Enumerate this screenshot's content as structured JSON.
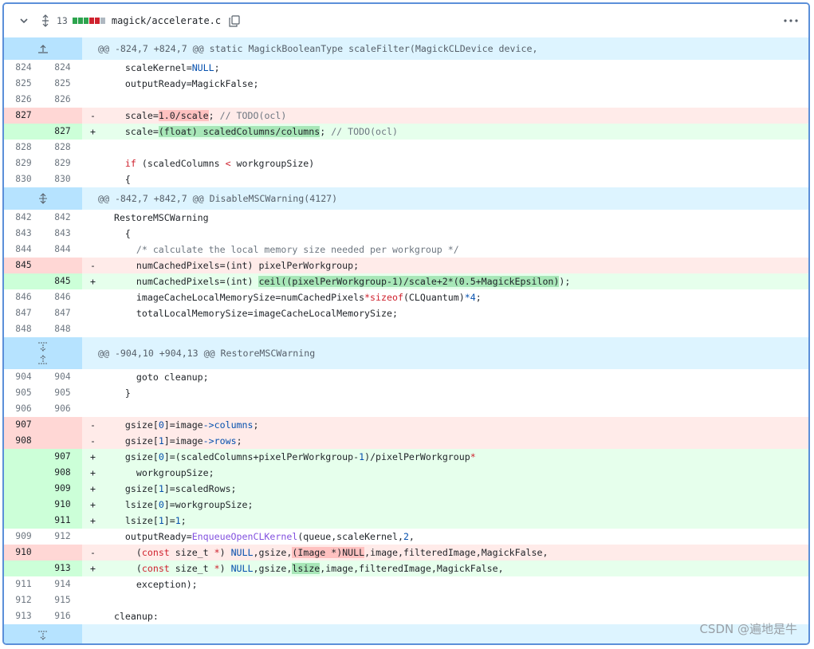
{
  "file": {
    "name": "magick/accelerate.c",
    "changes": "13",
    "diffstat": [
      "#2da44e",
      "#2da44e",
      "#2da44e",
      "#cf222e",
      "#cf222e",
      "#afb8c1"
    ]
  },
  "hunks": {
    "h1": "@@ -824,7 +824,7 @@ static MagickBooleanType scaleFilter(MagickCLDevice device,",
    "h2": "@@ -842,7 +842,7 @@ DisableMSCWarning(4127)",
    "h3": "@@ -904,10 +904,13 @@ RestoreMSCWarning"
  },
  "lines": {
    "l824": {
      "o": "824",
      "n": "824"
    },
    "l825": {
      "o": "825",
      "n": "825"
    },
    "l826": {
      "o": "826",
      "n": "826"
    },
    "l827d": {
      "o": "827",
      "s": "-"
    },
    "l827a": {
      "n": "827",
      "s": "+"
    },
    "l828": {
      "o": "828",
      "n": "828"
    },
    "l829": {
      "o": "829",
      "n": "829"
    },
    "l830": {
      "o": "830",
      "n": "830"
    },
    "l842": {
      "o": "842",
      "n": "842"
    },
    "l843": {
      "o": "843",
      "n": "843"
    },
    "l844": {
      "o": "844",
      "n": "844"
    },
    "l845d": {
      "o": "845",
      "s": "-"
    },
    "l845a": {
      "n": "845",
      "s": "+"
    },
    "l846": {
      "o": "846",
      "n": "846"
    },
    "l847": {
      "o": "847",
      "n": "847"
    },
    "l848": {
      "o": "848",
      "n": "848"
    },
    "l904": {
      "o": "904",
      "n": "904"
    },
    "l905": {
      "o": "905",
      "n": "905"
    },
    "l906": {
      "o": "906",
      "n": "906"
    },
    "l907d": {
      "o": "907",
      "s": "-"
    },
    "l908d": {
      "o": "908",
      "s": "-"
    },
    "a907": {
      "n": "907",
      "s": "+"
    },
    "a908": {
      "n": "908",
      "s": "+"
    },
    "a909": {
      "n": "909",
      "s": "+"
    },
    "a910": {
      "n": "910",
      "s": "+"
    },
    "a911": {
      "n": "911",
      "s": "+"
    },
    "l909": {
      "o": "909",
      "n": "912"
    },
    "l910d": {
      "o": "910",
      "s": "-"
    },
    "a913": {
      "n": "913",
      "s": "+"
    },
    "l911": {
      "o": "911",
      "n": "914"
    },
    "l912": {
      "o": "912",
      "n": "915"
    },
    "l913": {
      "o": "913",
      "n": "916"
    }
  },
  "code": {
    "c824a": "    scaleKernel=",
    "c824b": "NULL",
    "c824c": ";",
    "c825": "    outputReady=MagickFalse;",
    "c827d1": "    scale=",
    "c827d2": "1.0/scale",
    "c827d3": "; ",
    "c827d4": "// TODO(ocl)",
    "c827a1": "    scale=",
    "c827a2": "(float) scaledColumns/columns",
    "c827a3": "; ",
    "c827a4": "// TODO(ocl)",
    "c829a": "    ",
    "c829b": "if",
    "c829c": " (scaledColumns ",
    "c829d": "<",
    "c829e": " workgroupSize)",
    "c830": "    {",
    "c842": "  RestoreMSCWarning",
    "c843": "    {",
    "c844": "      /* calculate the local memory size needed per workgroup */",
    "c845d1": "      numCachedPixels=",
    "c845d2": "(int)",
    "c845d3": " pixelPerWorkgroup;",
    "c845a1": "      numCachedPixels=",
    "c845a2": "(int)",
    "c845a3": " ",
    "c845a4": "ceil((pixelPerWorkgroup",
    "c845a5": "-1)/scale+2*(0.5+MagickEpsilon)",
    "c845a6": ");",
    "c846a": "      imageCacheLocalMemorySize=numCachedPixels",
    "c846b": "*",
    "c846c": "sizeof",
    "c846d": "(CLQuantum)",
    "c846e": "*4",
    "c846f": ";",
    "c847": "      totalLocalMemorySize=imageCacheLocalMemorySize;",
    "c904": "      goto cleanup;",
    "c905": "    }",
    "c907da": "    gsize[",
    "c907db": "0",
    "c907dc": "]=image",
    "c907dd": "->columns",
    "c907de": ";",
    "c908da": "    gsize[",
    "c908db": "1",
    "c908dc": "]=image",
    "c908dd": "->rows",
    "c908de": ";",
    "a907a": "    gsize[",
    "a907b": "0",
    "a907c": "]=(scaledColumns+pixelPerWorkgroup-",
    "a907d": "1",
    "a907e": ")/pixelPerWorkgroup",
    "a907f": "*",
    "a908": "      workgroupSize;",
    "a909a": "    gsize[",
    "a909b": "1",
    "a909c": "]=scaledRows;",
    "a910a": "    lsize[",
    "a910b": "0",
    "a910c": "]=workgroupSize;",
    "a911a": "    lsize[",
    "a911b": "1",
    "a911c": "]=",
    "a911d": "1",
    "a911e": ";",
    "c909a": "    outputReady=",
    "c909b": "EnqueueOpenCLKernel",
    "c909c": "(queue,scaleKernel,",
    "c909d": "2",
    "c909e": ",",
    "c910da": "      (",
    "c910db": "const",
    "c910dc": " size_t ",
    "c910dd": "*",
    "c910de": ") ",
    "c910df": "NULL",
    "c910dg": ",gsize,",
    "c910dh": "(Image *)",
    "c910di": "NULL",
    "c910dj": ",image,filteredImage,MagickFalse,",
    "a913a": "      (",
    "a913b": "const",
    "a913c": " size_t ",
    "a913d": "*",
    "a913e": ") ",
    "a913f": "NULL",
    "a913g": ",gsize,",
    "a913h": "lsize",
    "a913i": ",image,filteredImage,MagickFalse,",
    "c911": "      exception);",
    "c913": "  cleanup:"
  },
  "watermark": "CSDN @遍地是牛"
}
